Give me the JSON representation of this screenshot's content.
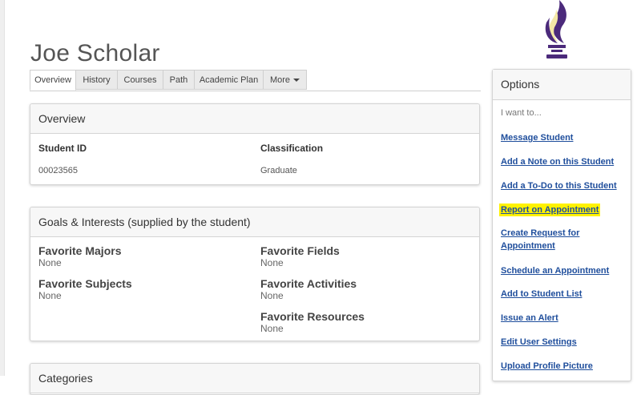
{
  "student": {
    "name": "Joe Scholar"
  },
  "brand": {
    "logo_color": "#4b2a7b",
    "flame_color": "#f3e7a6",
    "highlight_color": "#fff200",
    "link_color": "#1f4e9c"
  },
  "tabs": [
    {
      "label": "Overview",
      "active": true
    },
    {
      "label": "History"
    },
    {
      "label": "Courses"
    },
    {
      "label": "Path"
    },
    {
      "label": "Academic Plan"
    },
    {
      "label": "More",
      "icon": "caret-down-icon"
    }
  ],
  "overview": {
    "title": "Overview",
    "student_id_label": "Student ID",
    "student_id": "00023565",
    "classification_label": "Classification",
    "classification": "Graduate"
  },
  "goals": {
    "title": "Goals & Interests (supplied by the student)",
    "items": [
      {
        "label": "Favorite Majors",
        "value": "None"
      },
      {
        "label": "Favorite Fields",
        "value": "None"
      },
      {
        "label": "Favorite Subjects",
        "value": "None"
      },
      {
        "label": "Favorite Activities",
        "value": "None"
      },
      {
        "label": "Favorite Resources",
        "value": "None"
      }
    ]
  },
  "next_panel": {
    "title": "Categories"
  },
  "options": {
    "title": "Options",
    "prompt": "I want to...",
    "items": [
      {
        "label": "Message Student"
      },
      {
        "label": "Add a Note on this Student"
      },
      {
        "label": "Add a To-Do to this Student"
      },
      {
        "label": "Report on Appointment",
        "highlighted": true
      },
      {
        "label_line1": "Create Request for",
        "label_line2": "Appointment"
      },
      {
        "label": "Schedule an Appointment"
      },
      {
        "label": "Add to Student List"
      },
      {
        "label": "Issue an Alert"
      },
      {
        "label": "Edit User Settings"
      },
      {
        "label": "Upload Profile Picture"
      }
    ]
  }
}
